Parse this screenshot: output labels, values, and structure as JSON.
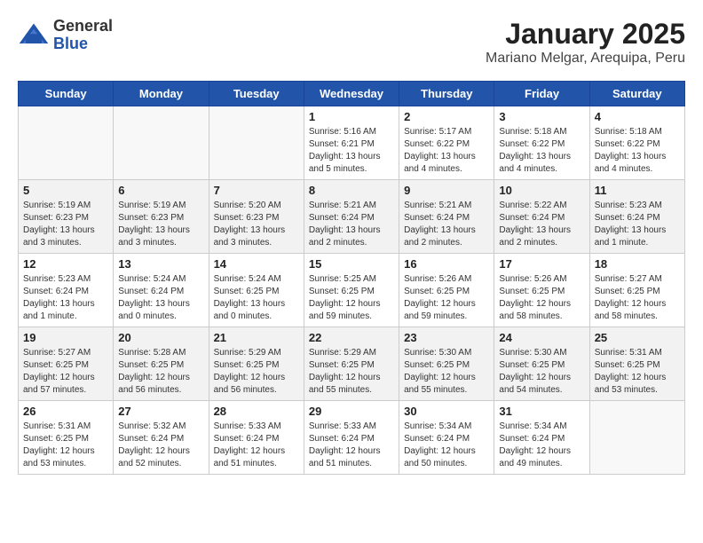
{
  "header": {
    "logo": {
      "general": "General",
      "blue": "Blue"
    },
    "title": "January 2025",
    "subtitle": "Mariano Melgar, Arequipa, Peru"
  },
  "weekdays": [
    "Sunday",
    "Monday",
    "Tuesday",
    "Wednesday",
    "Thursday",
    "Friday",
    "Saturday"
  ],
  "weeks": [
    [
      {
        "day": "",
        "info": ""
      },
      {
        "day": "",
        "info": ""
      },
      {
        "day": "",
        "info": ""
      },
      {
        "day": "1",
        "info": "Sunrise: 5:16 AM\nSunset: 6:21 PM\nDaylight: 13 hours\nand 5 minutes."
      },
      {
        "day": "2",
        "info": "Sunrise: 5:17 AM\nSunset: 6:22 PM\nDaylight: 13 hours\nand 4 minutes."
      },
      {
        "day": "3",
        "info": "Sunrise: 5:18 AM\nSunset: 6:22 PM\nDaylight: 13 hours\nand 4 minutes."
      },
      {
        "day": "4",
        "info": "Sunrise: 5:18 AM\nSunset: 6:22 PM\nDaylight: 13 hours\nand 4 minutes."
      }
    ],
    [
      {
        "day": "5",
        "info": "Sunrise: 5:19 AM\nSunset: 6:23 PM\nDaylight: 13 hours\nand 3 minutes."
      },
      {
        "day": "6",
        "info": "Sunrise: 5:19 AM\nSunset: 6:23 PM\nDaylight: 13 hours\nand 3 minutes."
      },
      {
        "day": "7",
        "info": "Sunrise: 5:20 AM\nSunset: 6:23 PM\nDaylight: 13 hours\nand 3 minutes."
      },
      {
        "day": "8",
        "info": "Sunrise: 5:21 AM\nSunset: 6:24 PM\nDaylight: 13 hours\nand 2 minutes."
      },
      {
        "day": "9",
        "info": "Sunrise: 5:21 AM\nSunset: 6:24 PM\nDaylight: 13 hours\nand 2 minutes."
      },
      {
        "day": "10",
        "info": "Sunrise: 5:22 AM\nSunset: 6:24 PM\nDaylight: 13 hours\nand 2 minutes."
      },
      {
        "day": "11",
        "info": "Sunrise: 5:23 AM\nSunset: 6:24 PM\nDaylight: 13 hours\nand 1 minute."
      }
    ],
    [
      {
        "day": "12",
        "info": "Sunrise: 5:23 AM\nSunset: 6:24 PM\nDaylight: 13 hours\nand 1 minute."
      },
      {
        "day": "13",
        "info": "Sunrise: 5:24 AM\nSunset: 6:24 PM\nDaylight: 13 hours\nand 0 minutes."
      },
      {
        "day": "14",
        "info": "Sunrise: 5:24 AM\nSunset: 6:25 PM\nDaylight: 13 hours\nand 0 minutes."
      },
      {
        "day": "15",
        "info": "Sunrise: 5:25 AM\nSunset: 6:25 PM\nDaylight: 12 hours\nand 59 minutes."
      },
      {
        "day": "16",
        "info": "Sunrise: 5:26 AM\nSunset: 6:25 PM\nDaylight: 12 hours\nand 59 minutes."
      },
      {
        "day": "17",
        "info": "Sunrise: 5:26 AM\nSunset: 6:25 PM\nDaylight: 12 hours\nand 58 minutes."
      },
      {
        "day": "18",
        "info": "Sunrise: 5:27 AM\nSunset: 6:25 PM\nDaylight: 12 hours\nand 58 minutes."
      }
    ],
    [
      {
        "day": "19",
        "info": "Sunrise: 5:27 AM\nSunset: 6:25 PM\nDaylight: 12 hours\nand 57 minutes."
      },
      {
        "day": "20",
        "info": "Sunrise: 5:28 AM\nSunset: 6:25 PM\nDaylight: 12 hours\nand 56 minutes."
      },
      {
        "day": "21",
        "info": "Sunrise: 5:29 AM\nSunset: 6:25 PM\nDaylight: 12 hours\nand 56 minutes."
      },
      {
        "day": "22",
        "info": "Sunrise: 5:29 AM\nSunset: 6:25 PM\nDaylight: 12 hours\nand 55 minutes."
      },
      {
        "day": "23",
        "info": "Sunrise: 5:30 AM\nSunset: 6:25 PM\nDaylight: 12 hours\nand 55 minutes."
      },
      {
        "day": "24",
        "info": "Sunrise: 5:30 AM\nSunset: 6:25 PM\nDaylight: 12 hours\nand 54 minutes."
      },
      {
        "day": "25",
        "info": "Sunrise: 5:31 AM\nSunset: 6:25 PM\nDaylight: 12 hours\nand 53 minutes."
      }
    ],
    [
      {
        "day": "26",
        "info": "Sunrise: 5:31 AM\nSunset: 6:25 PM\nDaylight: 12 hours\nand 53 minutes."
      },
      {
        "day": "27",
        "info": "Sunrise: 5:32 AM\nSunset: 6:24 PM\nDaylight: 12 hours\nand 52 minutes."
      },
      {
        "day": "28",
        "info": "Sunrise: 5:33 AM\nSunset: 6:24 PM\nDaylight: 12 hours\nand 51 minutes."
      },
      {
        "day": "29",
        "info": "Sunrise: 5:33 AM\nSunset: 6:24 PM\nDaylight: 12 hours\nand 51 minutes."
      },
      {
        "day": "30",
        "info": "Sunrise: 5:34 AM\nSunset: 6:24 PM\nDaylight: 12 hours\nand 50 minutes."
      },
      {
        "day": "31",
        "info": "Sunrise: 5:34 AM\nSunset: 6:24 PM\nDaylight: 12 hours\nand 49 minutes."
      },
      {
        "day": "",
        "info": ""
      }
    ]
  ]
}
